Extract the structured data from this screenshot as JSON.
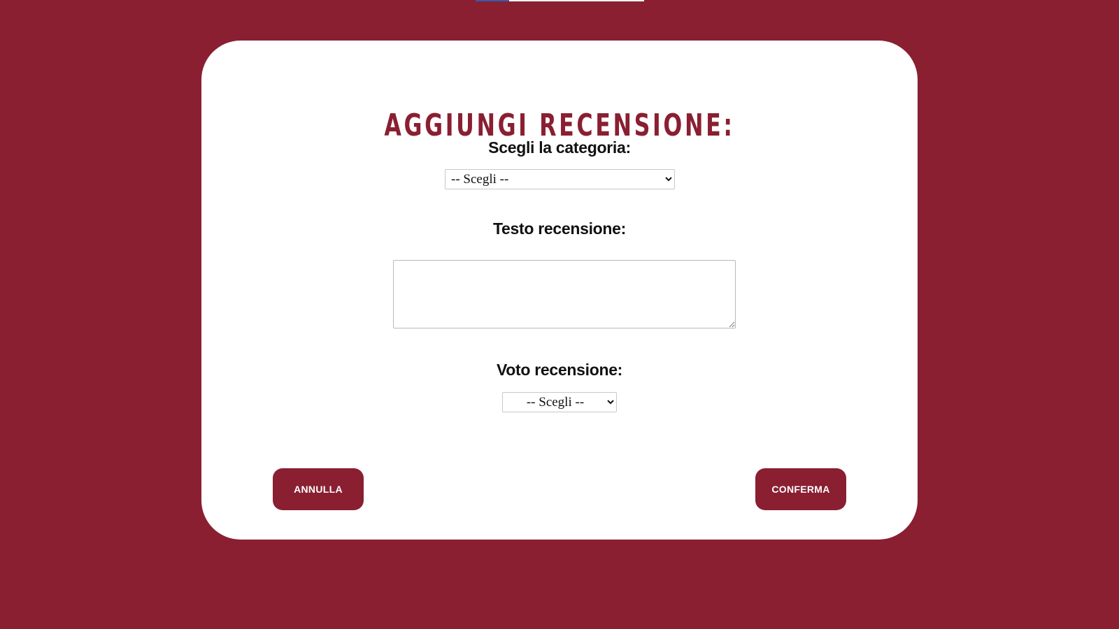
{
  "form": {
    "title": "AGGIUNGI RECENSIONE:",
    "category_label": "Scegli la categoria:",
    "category_select": {
      "selected": "-- Scegli --"
    },
    "text_label": "Testo recensione:",
    "text_value": "",
    "vote_label": "Voto recensione:",
    "vote_select": {
      "selected": "-- Scegli --"
    },
    "cancel_label": "ANNULLA",
    "confirm_label": "CONFERMA"
  },
  "colors": {
    "background": "#8a1f32",
    "card": "#ffffff",
    "accent": "#8a1f32",
    "text": "#111111"
  }
}
